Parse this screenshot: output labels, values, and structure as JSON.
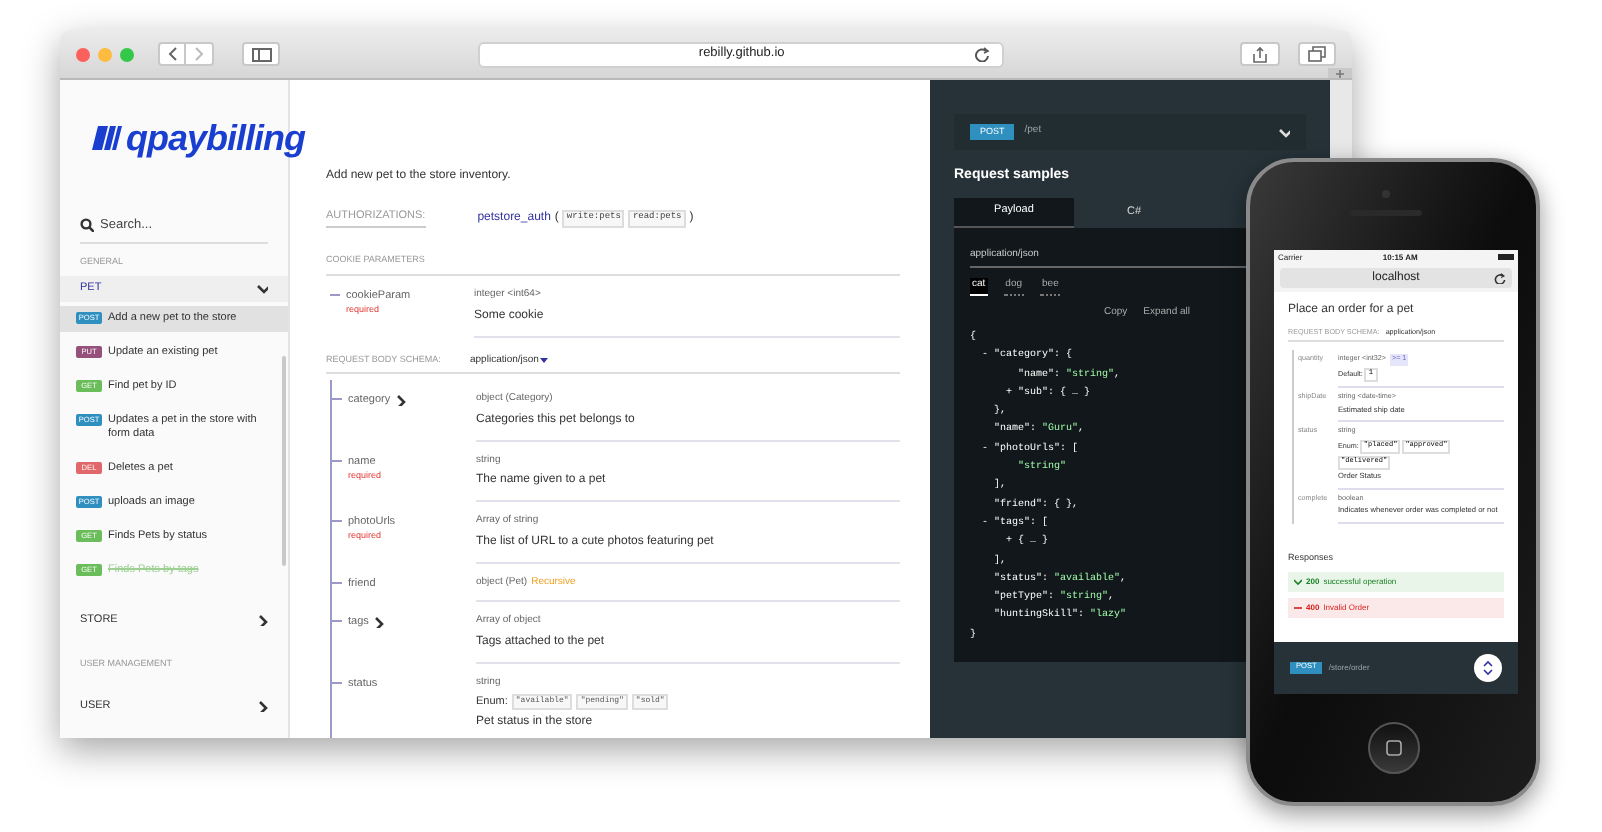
{
  "browser": {
    "url": "rebilly.github.io"
  },
  "sidebar": {
    "logo": "qpaybilling",
    "search_placeholder": "Search...",
    "sections": [
      {
        "heading": "GENERAL",
        "groups": [
          {
            "label": "PET",
            "expanded": true,
            "items": [
              {
                "method": "POST",
                "color": "#2f8fbf",
                "label": "Add a new pet to the store",
                "selected": true,
                "deprecated": false
              },
              {
                "method": "PUT",
                "color": "#95507c",
                "label": "Update an existing pet",
                "selected": false,
                "deprecated": false
              },
              {
                "method": "GET",
                "color": "#6bbd5b",
                "label": "Find pet by ID",
                "selected": false,
                "deprecated": false
              },
              {
                "method": "POST",
                "color": "#2f8fbf",
                "label": "Updates a pet in the store with form data",
                "selected": false,
                "deprecated": false
              },
              {
                "method": "DEL",
                "color": "#e0686a",
                "label": "Deletes a pet",
                "selected": false,
                "deprecated": false
              },
              {
                "method": "POST",
                "color": "#2f8fbf",
                "label": "uploads an image",
                "selected": false,
                "deprecated": false
              },
              {
                "method": "GET",
                "color": "#6bbd5b",
                "label": "Finds Pets by status",
                "selected": false,
                "deprecated": false
              },
              {
                "method": "GET",
                "color": "#6bbd5b",
                "label": "Finds Pets by tags",
                "selected": false,
                "deprecated": true
              }
            ]
          },
          {
            "label": "STORE",
            "expanded": false
          }
        ]
      },
      {
        "heading": "USER MANAGEMENT",
        "groups": [
          {
            "label": "USER",
            "expanded": false
          }
        ]
      }
    ]
  },
  "operation": {
    "description": "Add new pet to the store inventory.",
    "auth_label": "AUTHORIZATIONS:",
    "auth_name": "petstore_auth",
    "auth_open": "(",
    "auth_close": ")",
    "scopes": [
      "write:pets",
      "read:pets"
    ],
    "cookie_heading": "COOKIE PARAMETERS",
    "cookie_params": [
      {
        "name": "cookieParam",
        "note": "required",
        "type": "integer <int64>",
        "description": "Some cookie"
      }
    ],
    "body_label": "REQUEST BODY SCHEMA:",
    "content_type": "application/json",
    "fields": [
      {
        "name": "category",
        "expandable": true,
        "type": "object (Category)",
        "description": "Categories this pet belongs to"
      },
      {
        "name": "name",
        "note": "required",
        "type": "string",
        "description": "The name given to a pet"
      },
      {
        "name": "photoUrls",
        "note": "required",
        "type": "Array of string",
        "description": "The list of URL to a cute photos featuring pet"
      },
      {
        "name": "friend",
        "type": "object (Pet)",
        "recursive": "Recursive"
      },
      {
        "name": "tags",
        "expandable": true,
        "type": "Array of object",
        "description": "Tags attached to the pet"
      },
      {
        "name": "status",
        "type": "string",
        "enum_label": "Enum:",
        "enum": [
          "\"available\"",
          "\"pending\"",
          "\"sold\""
        ],
        "description": "Pet status in the store"
      }
    ]
  },
  "samples": {
    "method": "POST",
    "path": "/pet",
    "heading": "Request samples",
    "tabs": [
      {
        "label": "Payload",
        "selected": true
      },
      {
        "label": "C#",
        "selected": false
      }
    ],
    "content_type": "application/json",
    "examples": [
      {
        "label": "cat",
        "selected": true
      },
      {
        "label": "dog",
        "selected": false
      },
      {
        "label": "bee",
        "selected": false
      }
    ],
    "actions": [
      "Copy",
      "Expand all"
    ],
    "code": [
      [
        {
          "kind": "plain",
          "text": "{"
        }
      ],
      [
        {
          "kind": "plain",
          "text": "  - \"category\": {"
        }
      ],
      [
        {
          "kind": "plain",
          "text": "        \"name\": "
        },
        {
          "kind": "string",
          "text": "\"string\""
        },
        {
          "kind": "plain",
          "text": ","
        }
      ],
      [
        {
          "kind": "plain",
          "text": "      + \"sub\": { … }"
        }
      ],
      [
        {
          "kind": "plain",
          "text": "    },"
        }
      ],
      [
        {
          "kind": "plain",
          "text": "    \"name\": "
        },
        {
          "kind": "string",
          "text": "\"Guru\""
        },
        {
          "kind": "plain",
          "text": ","
        }
      ],
      [
        {
          "kind": "plain",
          "text": "  - \"photoUrls\": ["
        }
      ],
      [
        {
          "kind": "string",
          "text": "        \"string\""
        }
      ],
      [
        {
          "kind": "plain",
          "text": "    ],"
        }
      ],
      [
        {
          "kind": "plain",
          "text": "    \"friend\": { },"
        }
      ],
      [
        {
          "kind": "plain",
          "text": "  - \"tags\": ["
        }
      ],
      [
        {
          "kind": "plain",
          "text": "      + { … }"
        }
      ],
      [
        {
          "kind": "plain",
          "text": "    ],"
        }
      ],
      [
        {
          "kind": "plain",
          "text": "    \"status\": "
        },
        {
          "kind": "string",
          "text": "\"available\""
        },
        {
          "kind": "plain",
          "text": ","
        }
      ],
      [
        {
          "kind": "plain",
          "text": "    \"petType\": "
        },
        {
          "kind": "string",
          "text": "\"string\""
        },
        {
          "kind": "plain",
          "text": ","
        }
      ],
      [
        {
          "kind": "plain",
          "text": "    \"huntingSkill\": "
        },
        {
          "kind": "string",
          "text": "\"lazy\""
        }
      ],
      [
        {
          "kind": "plain",
          "text": "}"
        }
      ]
    ]
  },
  "phone": {
    "carrier": "Carrier",
    "time": "10:15 AM",
    "url": "localhost",
    "title": "Place an order for a pet",
    "body_label": "REQUEST BODY SCHEMA:",
    "content_type": "application/json",
    "fields": [
      {
        "name": "quantity",
        "type": "integer <int32>",
        "badge": ">= 1",
        "default_label": "Default:",
        "default": "1"
      },
      {
        "name": "shipDate",
        "type": "string <date-time>",
        "description": "Estimated ship date"
      },
      {
        "name": "status",
        "type": "string",
        "enum_label": "Enum:",
        "enum": [
          "\"placed\"",
          "\"approved\"",
          "\"delivered\""
        ],
        "description": "Order Status"
      },
      {
        "name": "complete",
        "type": "boolean",
        "description": "Indicates whenever order was completed or not"
      }
    ],
    "responses_heading": "Responses",
    "responses": [
      {
        "kind": "success",
        "code": "200",
        "text": "successful operation"
      },
      {
        "kind": "error",
        "code": "400",
        "text": "Invalid Order"
      }
    ],
    "method": "POST",
    "path": "/store/order"
  }
}
